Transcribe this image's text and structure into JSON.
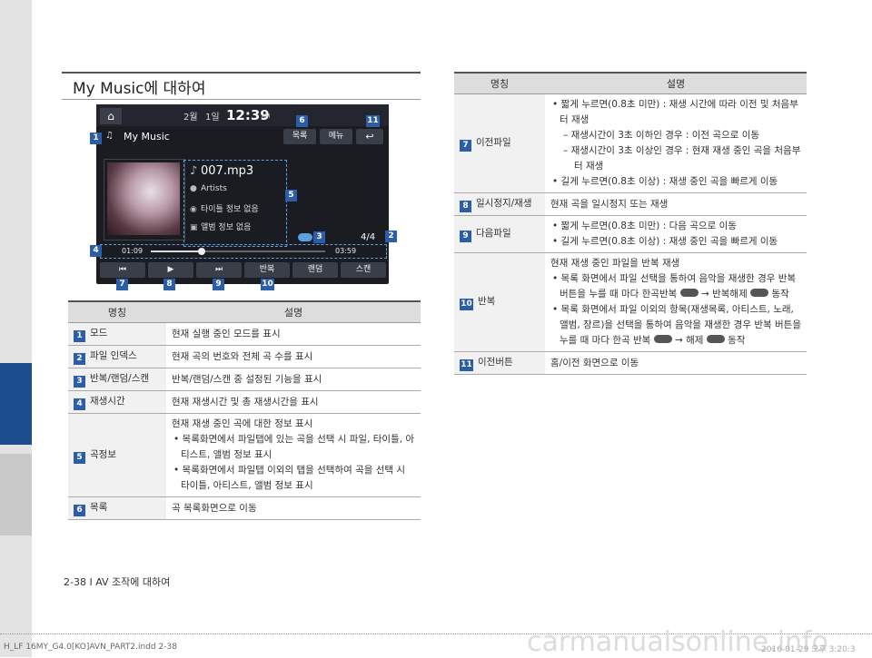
{
  "section_title": "My Music에 대하여",
  "screen": {
    "home_icon": "home-icon",
    "date_month": "2월",
    "date_day": "1일",
    "time": "12:39",
    "ampm": "AM",
    "mode_label": "My Music",
    "list_btn": "목록",
    "menu_btn": "메뉴",
    "back_icon": "back-arrow-icon",
    "file_name": "007.mp3",
    "artist": "Artists",
    "title": "타이틀 정보 없음",
    "album": "앨범 정보 없음",
    "file_index": "4/4",
    "elapsed": "01:09",
    "total": "03:59",
    "progress": 0.29,
    "controls": [
      "⏮",
      "▶",
      "⏭",
      "반복",
      "랜덤",
      "스캔"
    ]
  },
  "callouts": {
    "b1": "1",
    "b2": "2",
    "b3": "3",
    "b4": "4",
    "b5": "5",
    "b6": "6",
    "b7": "7",
    "b8": "8",
    "b9": "9",
    "b10": "10",
    "b11": "11"
  },
  "left_table": {
    "headers": [
      "명칭",
      "설명"
    ],
    "rows": [
      {
        "n": "1",
        "name": "모드",
        "desc": "현재 실행 중인 모드를 표시"
      },
      {
        "n": "2",
        "name": "파일 인덱스",
        "desc": "현재 곡의 번호와 전체 곡 수를 표시"
      },
      {
        "n": "3",
        "name": "반복/랜덤/스캔",
        "desc": "반복/랜덤/스캔 중 설정된 기능을 표시"
      },
      {
        "n": "4",
        "name": "재생시간",
        "desc": "현재 재생시간 및 총 재생시간을 표시"
      },
      {
        "n": "5",
        "name": "곡정보",
        "l1": "현재 재생 중인 곡에 대한 정보 표시",
        "l2": "• 목록화면에서 파일탭에 있는 곡을 선택 시 파일, 타이틀, 아티스트, 앨범 정보 표시",
        "l3": "• 목록화면에서 파일탭 이외의 탭을 선택하여 곡을 선택 시 타이틀, 아티스트, 앨범 정보 표시"
      },
      {
        "n": "6",
        "name": "목록",
        "desc": "곡 목록화면으로 이동"
      }
    ]
  },
  "right_table": {
    "headers": [
      "명칭",
      "설명"
    ],
    "r7": {
      "n": "7",
      "name": "이전파일",
      "l1": "• 짧게 누르면(0.8초 미만) : 재생 시간에 따라 이전 및 처음부터 재생",
      "l2": "– 재생시간이 3초 이하인 경우 : 이전 곡으로 이동",
      "l3": "– 재생시간이 3초 이상인 경우 : 현재 재생 중인 곡을 처음부터 재생",
      "l4": "• 길게 누르면(0.8초 이상) : 재생 중인 곡을 빠르게 이동"
    },
    "r8": {
      "n": "8",
      "name": "일시정지/재생",
      "desc": "현재 곡을 일시정지 또는 재생"
    },
    "r9": {
      "n": "9",
      "name": "다음파일",
      "l1": "• 짧게 누르면(0.8초 미만) : 다음 곡으로 이동",
      "l2": "• 길게 누르면(0.8초 이상) : 재생 중인 곡을 빠르게 이동"
    },
    "r10": {
      "n": "10",
      "name": "반복",
      "l1": "현재 재생 중인 파일을 반복 재생",
      "l2a": "• 목록 화면에서 파일 선택을 통하여 음악을 재생한 경우 반복 버튼을 누를 때 마다 한곡반복",
      "l2b": "→ 반복해제",
      "l2c": "동작",
      "l3a": "• 목록 화면에서 파일 이외의 항목(재생목록, 아티스트, 노래, 앨범, 장르)을 선택을 통하여 음악을 재생한 경우 반복 버튼을 누를 때 마다 한곡 반복",
      "l3b": "→ 해제",
      "l3c": "동작"
    },
    "r11": {
      "n": "11",
      "name": "이전버튼",
      "desc": "홈/이전 화면으로 이동"
    }
  },
  "footer": "2-38 I AV 조작에 대하여",
  "print_left": "H_LF 16MY_G4.0[KO]AVN_PART2.indd   2-38",
  "print_right": "2016-01-29   오후 3:20:3",
  "watermark": "carmanualsonline.info"
}
